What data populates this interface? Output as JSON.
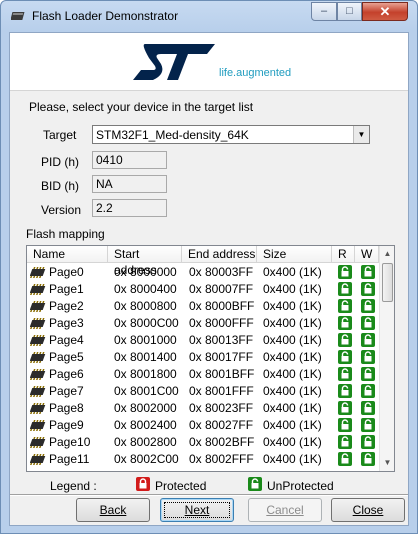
{
  "window": {
    "title": "Flash Loader Demonstrator",
    "buttons": {
      "minimize": "–",
      "maximize": "□",
      "close": "✕"
    }
  },
  "banner": {
    "logo_icon": "st-logo",
    "tagline": "life.augmented"
  },
  "form": {
    "prompt": "Please, select your device in the target list",
    "target_label": "Target",
    "target_value": "STM32F1_Med-density_64K",
    "pid_label": "PID  (h)",
    "pid_value": "0410",
    "bid_label": "BID  (h)",
    "bid_value": "NA",
    "version_label": "Version",
    "version_value": "2.2"
  },
  "flash_mapping": {
    "label": "Flash mapping",
    "columns": [
      "Name",
      "Start address",
      "End address",
      "Size",
      "R",
      "W"
    ],
    "rows": [
      {
        "name": "Page0",
        "start": "0x 8000000",
        "end": "0x 80003FF",
        "size": "0x400 (1K)",
        "r": "unprotected",
        "w": "unprotected"
      },
      {
        "name": "Page1",
        "start": "0x 8000400",
        "end": "0x 80007FF",
        "size": "0x400 (1K)",
        "r": "unprotected",
        "w": "unprotected"
      },
      {
        "name": "Page2",
        "start": "0x 8000800",
        "end": "0x 8000BFF",
        "size": "0x400 (1K)",
        "r": "unprotected",
        "w": "unprotected"
      },
      {
        "name": "Page3",
        "start": "0x 8000C00",
        "end": "0x 8000FFF",
        "size": "0x400 (1K)",
        "r": "unprotected",
        "w": "unprotected"
      },
      {
        "name": "Page4",
        "start": "0x 8001000",
        "end": "0x 80013FF",
        "size": "0x400 (1K)",
        "r": "unprotected",
        "w": "unprotected"
      },
      {
        "name": "Page5",
        "start": "0x 8001400",
        "end": "0x 80017FF",
        "size": "0x400 (1K)",
        "r": "unprotected",
        "w": "unprotected"
      },
      {
        "name": "Page6",
        "start": "0x 8001800",
        "end": "0x 8001BFF",
        "size": "0x400 (1K)",
        "r": "unprotected",
        "w": "unprotected"
      },
      {
        "name": "Page7",
        "start": "0x 8001C00",
        "end": "0x 8001FFF",
        "size": "0x400 (1K)",
        "r": "unprotected",
        "w": "unprotected"
      },
      {
        "name": "Page8",
        "start": "0x 8002000",
        "end": "0x 80023FF",
        "size": "0x400 (1K)",
        "r": "unprotected",
        "w": "unprotected"
      },
      {
        "name": "Page9",
        "start": "0x 8002400",
        "end": "0x 80027FF",
        "size": "0x400 (1K)",
        "r": "unprotected",
        "w": "unprotected"
      },
      {
        "name": "Page10",
        "start": "0x 8002800",
        "end": "0x 8002BFF",
        "size": "0x400 (1K)",
        "r": "unprotected",
        "w": "unprotected"
      },
      {
        "name": "Page11",
        "start": "0x 8002C00",
        "end": "0x 8002FFF",
        "size": "0x400 (1K)",
        "r": "unprotected",
        "w": "unprotected"
      }
    ]
  },
  "legend": {
    "label": "Legend :",
    "protected_label": "Protected",
    "unprotected_label": "UnProtected"
  },
  "colors": {
    "protected": "#d21b1b",
    "unprotected": "#1a8a1a",
    "st_blue": "#03234b",
    "tagline": "#1f9cbf"
  },
  "footer": {
    "back": "Back",
    "next": "Next",
    "cancel": "Cancel",
    "close": "Close"
  }
}
